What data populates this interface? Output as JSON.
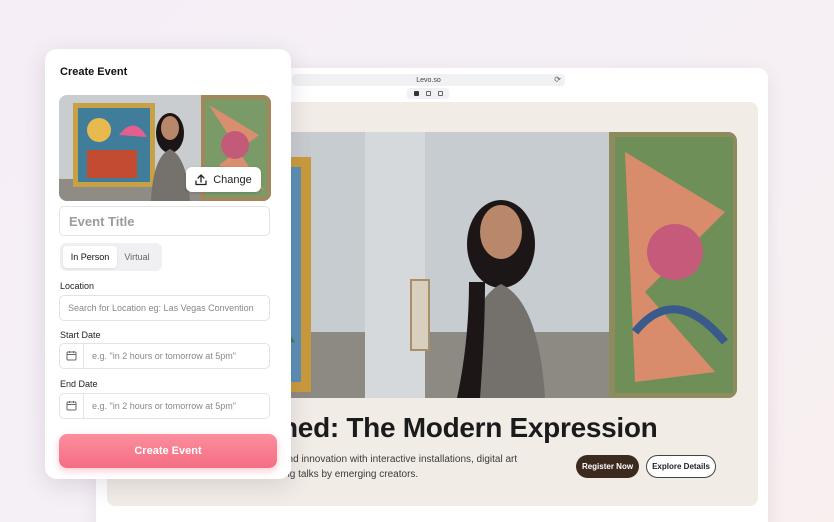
{
  "browser": {
    "url": "Levo.so",
    "reload_icon": "reload-icon",
    "device_icons": [
      "desktop-icon",
      "tablet-icon",
      "phone-icon"
    ]
  },
  "hero": {
    "title": "ned: The Modern Expression",
    "description_line1": "and innovation with interactive installations, digital art",
    "description_line2": "ing talks by emerging creators.",
    "register_label": "Register Now",
    "details_label": "Explore Details"
  },
  "create_event": {
    "heading": "Create Event",
    "change_label": "Change",
    "title_placeholder": "Event Title",
    "mode_tabs": [
      {
        "label": "In Person",
        "active": true
      },
      {
        "label": "Virtual",
        "active": false
      }
    ],
    "location_label": "Location",
    "location_placeholder": "Search for Location eg: Las Vegas Convention",
    "start_label": "Start Date",
    "start_placeholder": "e.g. \"in 2 hours or tomorrow at 5pm\"",
    "end_label": "End Date",
    "end_placeholder": "e.g. \"in 2 hours or tomorrow at 5pm\"",
    "submit_label": "Create Event"
  },
  "colors": {
    "primary_gradient_start": "#fb8f9d",
    "primary_gradient_end": "#f56d83",
    "register_bg": "#3c2a1e",
    "hero_bg": "#f1ece6"
  }
}
